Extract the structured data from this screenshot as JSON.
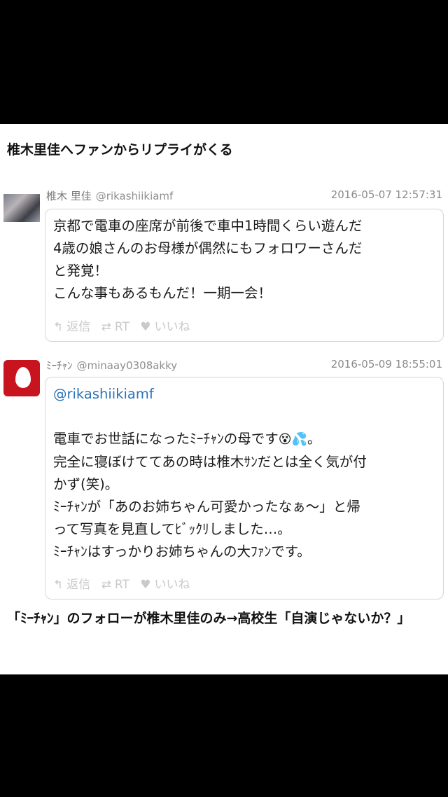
{
  "headline": "椎木里佳へファンからリプライがくる",
  "tweet1": {
    "name": "椎木 里佳",
    "handle": "@rikashiikiamf",
    "date": "2016-05-07 12:57:31",
    "body": "京都で電車の座席が前後で車中1時間くらい遊んだ\n4歳の娘さんのお母様が偶然にもフォロワーさんだ\nと発覚！\nこんな事もあるもんだ！一期一会！",
    "reply_label": "返信",
    "rt_label": "RT",
    "like_label": "いいね"
  },
  "tweet2": {
    "name": "ﾐｰﾁｬﾝ",
    "handle": "@minaay0308akky",
    "date": "2016-05-09 18:55:01",
    "mention": "@rikashiikiamf",
    "line1": "電車でお世話になったﾐｰﾁｬﾝの母です",
    "line1_end": "。",
    "body_rest": "完全に寝ぼけててあの時は椎木ｻﾝだとは全く気が付\nかず(笑)。\nﾐｰﾁｬﾝが「あのお姉ちゃん可愛かったなぁ〜」と帰\nって写真を見直してﾋﾞｯｸﾘしました…。\nﾐｰﾁｬﾝはすっかりお姉ちゃんの大ﾌｧﾝです。",
    "reply_label": "返信",
    "rt_label": "RT",
    "like_label": "いいね"
  },
  "footer": "「ﾐｰﾁｬﾝ」のフォローが椎木里佳のみ→高校生「自演じゃないか？」",
  "icons": {
    "reply": "reply-icon",
    "retweet": "retweet-icon",
    "like": "heart-icon",
    "emoji_dizzy": "dizzy-face-emoji",
    "emoji_sweat": "sweat-drops-emoji"
  },
  "colors": {
    "mention": "#2a73b8",
    "avatar2_bg": "#c8141e",
    "action_gray": "#c9c9c9"
  }
}
